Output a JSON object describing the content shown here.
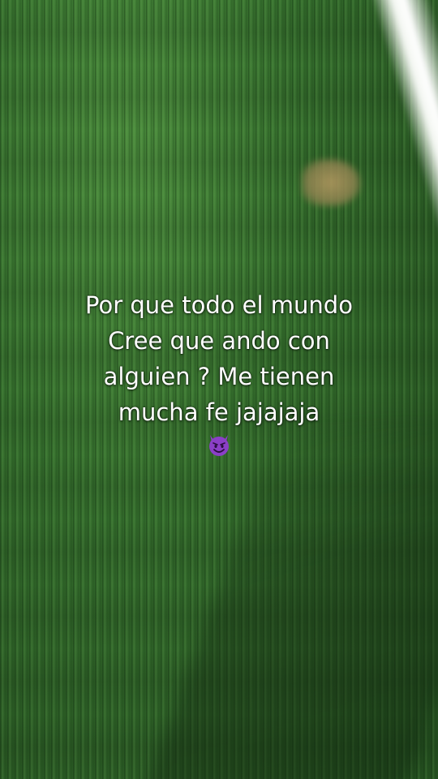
{
  "caption": {
    "lines": [
      "Por que todo el mundo",
      "Cree que ando con",
      "alguien ? Me tienen",
      "mucha fe jajajaja"
    ],
    "emoji": "smiling-devil-icon"
  },
  "colors": {
    "grass": "#356f2d",
    "text": "#ffffff",
    "emoji": "#8b3fc7"
  }
}
